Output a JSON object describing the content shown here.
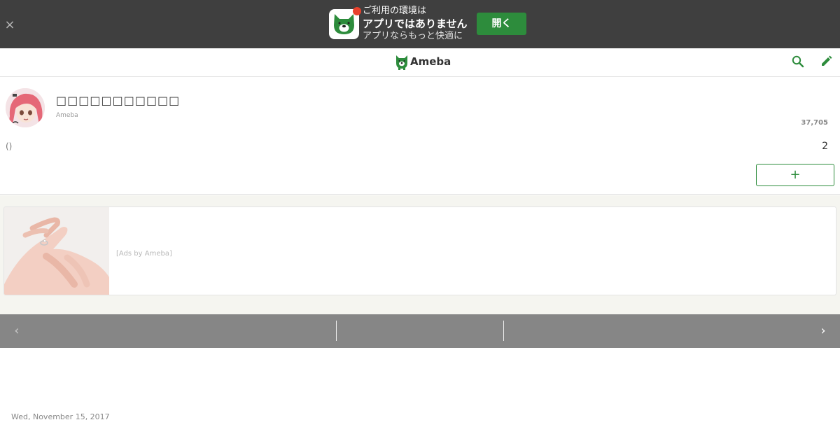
{
  "app_banner": {
    "line1": "ご利用の環境は",
    "line2": "アプリではありません",
    "line3": "アプリならもっと快適に",
    "open_label": "開く",
    "close_glyph": "×"
  },
  "header": {
    "logo_text": "Ameba",
    "brand_color": "#2d8c3c",
    "icons": [
      "search-icon",
      "pencil-icon"
    ]
  },
  "profile": {
    "blog_title": "□□□□□□□□□□□",
    "author": "Ameba",
    "reader_count": "37,705",
    "paren_text": "()",
    "count": "2",
    "follow_label": "+"
  },
  "ad": {
    "label": "[Ads by Ameba]"
  },
  "nav": {
    "prev_glyph": "‹",
    "next_glyph": "›"
  },
  "article": {
    "date": "Wed, November 15, 2017"
  }
}
